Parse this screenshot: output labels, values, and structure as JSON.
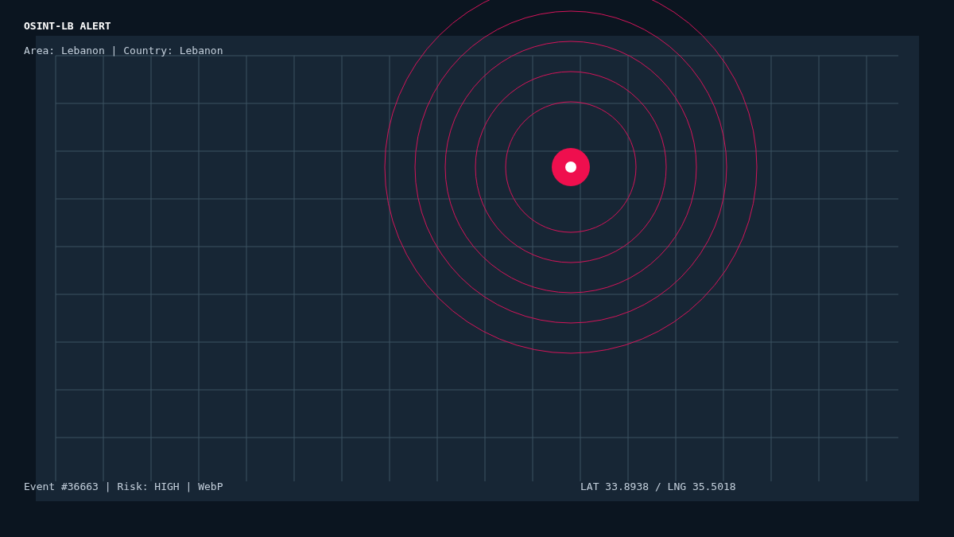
{
  "title": "OSINT-LB ALERT",
  "location_line": "Area: Lebanon | Country: Lebanon",
  "event_line": "Event #36663 | Risk: HIGH | WebP",
  "coordinates": "LAT 33.8938 / LNG 35.5018"
}
